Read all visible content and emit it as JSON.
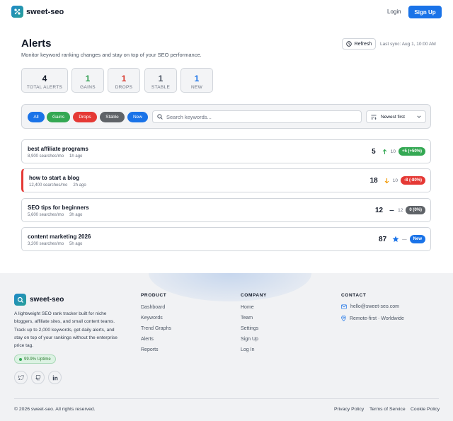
{
  "header": {
    "brand": "sweet-seo",
    "login_label": "Login",
    "signup_label": "Sign Up"
  },
  "page": {
    "title": "Alerts",
    "subtitle": "Monitor keyword ranking changes and stay on top of your SEO performance.",
    "refresh_label": "Refresh",
    "last_sync": "Last sync: Aug 1, 10:00 AM"
  },
  "stats": [
    {
      "value": "4",
      "label": "TOTAL ALERTS",
      "color": "#111827"
    },
    {
      "value": "1",
      "label": "GAINS",
      "color": "#2e9e4f"
    },
    {
      "value": "1",
      "label": "DROPS",
      "color": "#d93b30"
    },
    {
      "value": "1",
      "label": "STABLE",
      "color": "#4b5563"
    },
    {
      "value": "1",
      "label": "NEW",
      "color": "#1a73e8"
    }
  ],
  "filters": {
    "pills": [
      {
        "label": "All",
        "color": "#1a73e8"
      },
      {
        "label": "Gains",
        "color": "#34a853"
      },
      {
        "label": "Drops",
        "color": "#e53935"
      },
      {
        "label": "Stable",
        "color": "#5f6368"
      },
      {
        "label": "New",
        "color": "#1a73e8"
      }
    ],
    "search_placeholder": "Search keywords...",
    "sort_value": "Newest first"
  },
  "alerts": [
    {
      "keyword": "best affiliate programs",
      "searches": "8,900 searches/mo",
      "time": "1h ago",
      "rank": "5",
      "trend": "up",
      "previous": "10",
      "badge": "+5 (+50%)",
      "badge_color": "#34a853"
    },
    {
      "keyword": "how to start a blog",
      "searches": "12,400 searches/mo",
      "time": "2h ago",
      "rank": "18",
      "trend": "down",
      "previous": "10",
      "badge": "-8 (-80%)",
      "badge_color": "#e53935"
    },
    {
      "keyword": "SEO tips for beginners",
      "searches": "5,600 searches/mo",
      "time": "3h ago",
      "rank": "12",
      "trend": "flat",
      "previous": "12",
      "badge": "0 (0%)",
      "badge_color": "#5f6368"
    },
    {
      "keyword": "content marketing 2026",
      "searches": "3,200 searches/mo",
      "time": "5h ago",
      "rank": "87",
      "trend": "new",
      "previous": "—",
      "badge": "New",
      "badge_color": "#1a73e8"
    }
  ],
  "footer": {
    "brand": "sweet-seo",
    "description": "A lightweight SEO rank tracker built for niche bloggers, affiliate sites, and small content teams. Track up to 2,000 keywords, get daily alerts, and stay on top of your rankings without the enterprise price tag.",
    "uptime": "99.9% Uptime",
    "social_icons": [
      "twitter-icon",
      "github-icon",
      "linkedin-icon"
    ],
    "product": {
      "heading": "PRODUCT",
      "links": [
        "Dashboard",
        "Keywords",
        "Trend Graphs",
        "Alerts",
        "Reports"
      ]
    },
    "company": {
      "heading": "COMPANY",
      "links": [
        "Home",
        "Team",
        "Settings",
        "Sign Up",
        "Log In"
      ]
    },
    "contact": {
      "heading": "CONTACT",
      "email": "hello@sweet-seo.com",
      "location": "Remote-first · Worldwide"
    },
    "copyright": "© 2026 sweet-seo. All rights reserved.",
    "legal": [
      "Privacy Policy",
      "Terms of Service",
      "Cookie Policy"
    ]
  }
}
